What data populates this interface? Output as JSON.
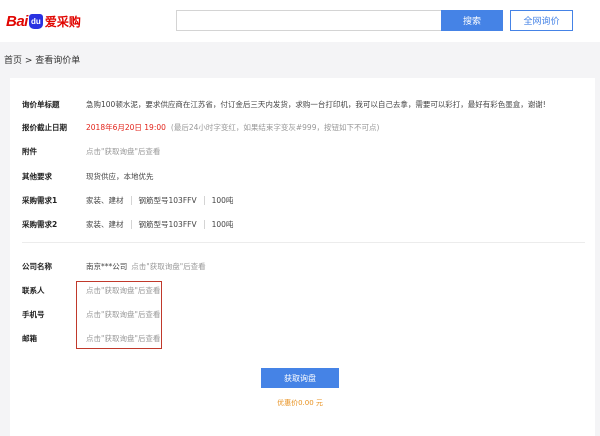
{
  "header": {
    "logo_bai": "Bai",
    "logo_du": "du",
    "logo_aicai": "爱采购",
    "search_placeholder": "",
    "search_button": "搜索",
    "all_inquiry_button": "全网询价"
  },
  "breadcrumb": "首页 > 查看询价单",
  "details": {
    "title_label": "询价单标题",
    "title_value": "急购100顿水泥，要求供应商在江苏省，付订金后三天内发货，求购一台打印机，我可以自己去拿，需要可以彩打，最好有彩色墨盒，谢谢!",
    "deadline_label": "报价截止日期",
    "deadline_value": "2018年6月20日  19:00",
    "deadline_note": "(最后24小时字变红，如果结束字变灰#999，按钮如下不可点)",
    "attachment_label": "附件",
    "attachment_value": "点击\"获取询盘\"后查看",
    "other_label": "其他要求",
    "other_value": "现货供应，本地优先",
    "req1_label": "采购需求1",
    "req1_category": "家装、建材",
    "req1_model": "钢筋型号103FFV",
    "req1_qty": "100吨",
    "req2_label": "采购需求2",
    "req2_category": "家装、建材",
    "req2_model": "钢筋型号103FFV",
    "req2_qty": "100吨"
  },
  "contact": {
    "company_label": "公司名称",
    "company_value": "南京***公司",
    "company_hint": "点击\"获取询盘\"后查看",
    "person_label": "联系人",
    "person_value": "点击\"获取询盘\"后查看",
    "phone_label": "手机号",
    "phone_value": "点击\"获取询盘\"后查看",
    "email_label": "邮箱",
    "email_value": "点击\"获取询盘\"后查看"
  },
  "action": {
    "get_inquiry_button": "获取询盘",
    "price_text": "优惠价0.00 元"
  },
  "colors": {
    "accent": "#4583e6",
    "deadline": "#e2231a",
    "price": "#e8911f",
    "highlight_box": "#c0392b"
  }
}
